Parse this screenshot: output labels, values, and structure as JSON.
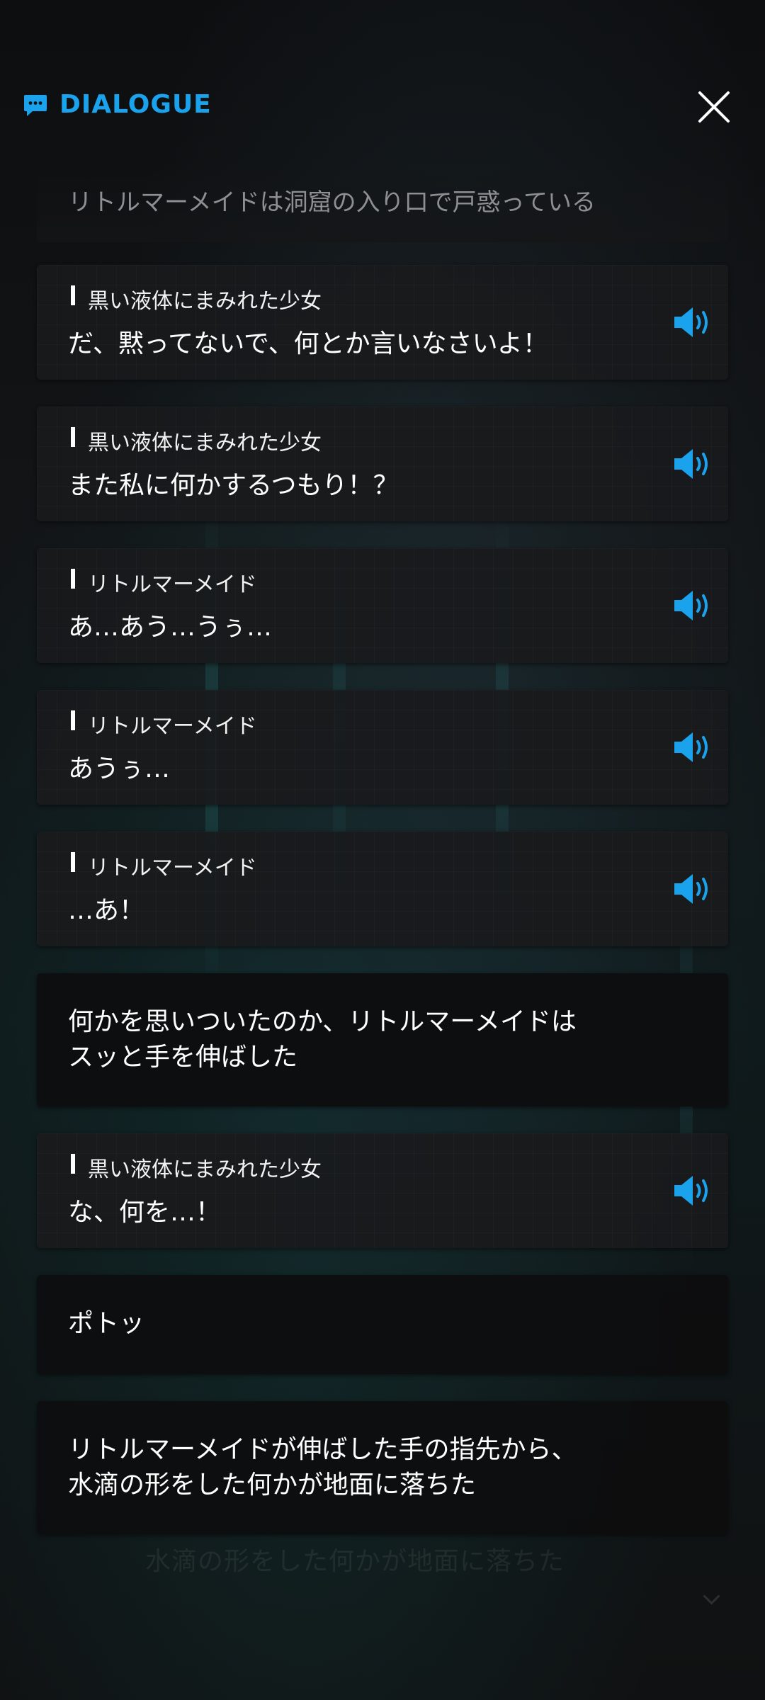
{
  "header": {
    "title": "DIALOGUE",
    "icon": "chat-bubble-icon",
    "close_icon": "close-icon",
    "accent_color": "#1aa3ec"
  },
  "log": {
    "intro_narration": "リトルマーメイドは洞窟の入り口で戸惑っている",
    "entries": [
      {
        "type": "voice",
        "speaker": "黒い液体にまみれた少女",
        "text": "だ、黙ってないで、何とか言いなさいよ！",
        "icon": "speaker-icon"
      },
      {
        "type": "voice",
        "speaker": "黒い液体にまみれた少女",
        "text": "また私に何かするつもり！？",
        "icon": "speaker-icon"
      },
      {
        "type": "voice",
        "speaker": "リトルマーメイド",
        "text": "あ…あう…うぅ…",
        "icon": "speaker-icon"
      },
      {
        "type": "voice",
        "speaker": "リトルマーメイド",
        "text": "あうぅ…",
        "icon": "speaker-icon"
      },
      {
        "type": "voice",
        "speaker": "リトルマーメイド",
        "text": "…あ！",
        "icon": "speaker-icon"
      },
      {
        "type": "narration",
        "lines": [
          "何かを思いついたのか、リトルマーメイドは",
          "スッと手を伸ばした"
        ]
      },
      {
        "type": "voice",
        "speaker": "黒い液体にまみれた少女",
        "text": "な、何を…！",
        "icon": "speaker-icon"
      },
      {
        "type": "narration",
        "lines": [
          "ポトッ"
        ]
      },
      {
        "type": "narration",
        "lines": [
          "リトルマーメイドが伸ばした手の指先から、",
          "水滴の形をした何かが地面に落ちた"
        ]
      }
    ]
  },
  "background": {
    "ghost_text": "水滴の形をした何かが地面に落ちた"
  }
}
